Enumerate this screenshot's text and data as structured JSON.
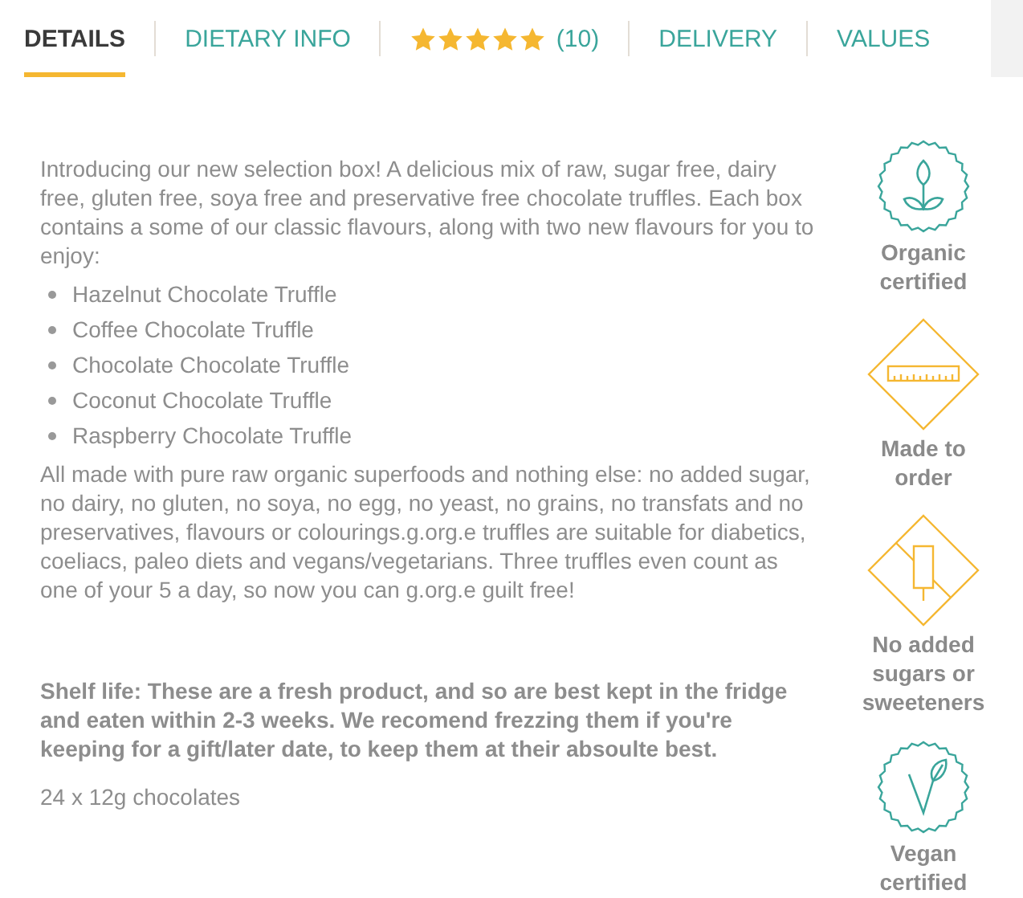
{
  "tabs": [
    {
      "kind": "text",
      "label": "DETAILS",
      "selected": true
    },
    {
      "kind": "text",
      "label": "DIETARY INFO",
      "selected": false
    },
    {
      "kind": "rating",
      "stars": 5,
      "label": "(10)",
      "selected": false
    },
    {
      "kind": "text",
      "label": "DELIVERY",
      "selected": false
    },
    {
      "kind": "text",
      "label": "VALUES",
      "selected": false
    }
  ],
  "intro": " Introducing our new selection box! A delicious mix of raw, sugar free, dairy free, gluten free, soya free and preservative  free  chocolate truffles. Each box contains a some of our classic flavours, along with two new flavours for you to enjoy:",
  "flavours": [
    "Hazelnut Chocolate Truffle",
    "Coffee Chocolate Truffle",
    "Chocolate Chocolate Truffle",
    "Coconut Chocolate Truffle",
    "Raspberry Chocolate Truffle"
  ],
  "body": "All made with  pure raw organic superfoods and nothing else: no added sugar, no dairy, no gluten, no soya, no egg, no yeast, no grains, no transfats and no preservatives, flavours or colourings.g.org.e truffles are suitable for diabetics, coeliacs, paleo diets and vegans/vegetarians. Three truffles even count as one of your 5 a day, so now you can g.org.e guilt free!",
  "shelf_life": "Shelf life: These are a fresh product, and so are best kept in the fridge and eaten within 2-3 weeks. We recomend frezzing them if you're keeping for a gift/later date, to keep them at their absoulte best.",
  "contents": "24 x 12g chocolates",
  "badges": [
    {
      "kind": "seal",
      "label": "Organic certified"
    },
    {
      "kind": "diamond",
      "label": "Made to order"
    },
    {
      "kind": "diamond",
      "label": "No added sugars or sweeteners"
    },
    {
      "kind": "seal",
      "label": "Vegan certified"
    }
  ]
}
